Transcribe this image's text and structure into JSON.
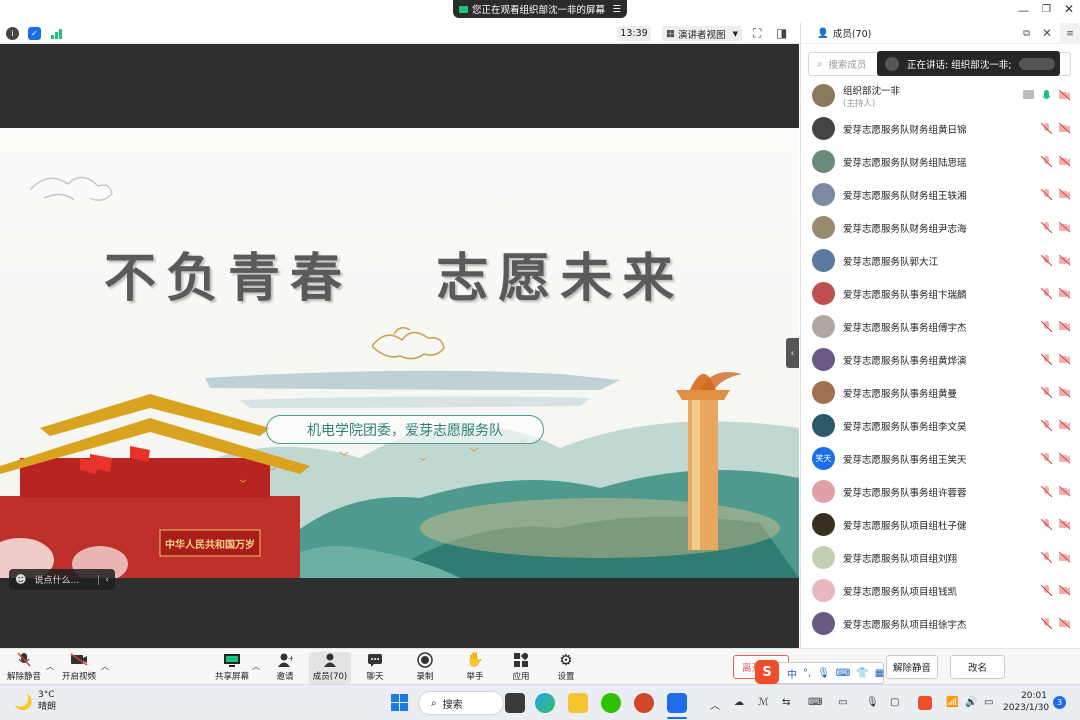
{
  "banner": {
    "text": "您正在观看组织部沈一非的屏幕"
  },
  "toolbar": {
    "time": "13:39",
    "view_label": "演讲者视图"
  },
  "slide": {
    "headline": "不负青春   志愿未来",
    "subtitle": "机电学院团委，爱芽志愿服务队"
  },
  "chat": {
    "placeholder": "说点什么..."
  },
  "panel": {
    "title": "成员(70)",
    "search_placeholder": "搜索成员",
    "speaking": "正在讲话: 组织部沈一非;"
  },
  "members": [
    {
      "name": "组织部沈一非",
      "role": "(主持人)",
      "color": "#8a7a5a"
    },
    {
      "name": "爱芽志愿服务队财务组黄日锦",
      "color": "#444"
    },
    {
      "name": "爱芽志愿服务队财务组陆思瑶",
      "color": "#6a8a7a"
    },
    {
      "name": "爱芽志愿服务队财务组王轶湘",
      "color": "#7a8aa0"
    },
    {
      "name": "爱芽志愿服务队财务组尹志海",
      "color": "#9a8a70"
    },
    {
      "name": "爱芽志愿服务队郭大江",
      "color": "#5a7aa0"
    },
    {
      "name": "爱芽志愿服务队事务组卞瑞麟",
      "color": "#c05050"
    },
    {
      "name": "爱芽志愿服务队事务组傅宇杰",
      "color": "#b0a8a0"
    },
    {
      "name": "爱芽志愿服务队事务组黄烨演",
      "color": "#6a5a8a"
    },
    {
      "name": "爱芽志愿服务队事务组黄曼",
      "color": "#a07050"
    },
    {
      "name": "爱芽志愿服务队事务组李文昊",
      "color": "#2a5a6a"
    },
    {
      "name": "爱芽志愿服务队事务组王笑天",
      "color": "#1a6ee8",
      "initials": "笑天"
    },
    {
      "name": "爱芽志愿服务队事务组许蓉蓉",
      "color": "#e0a0a8"
    },
    {
      "name": "爱芽志愿服务队项目组杜子健",
      "color": "#3a3020"
    },
    {
      "name": "爱芽志愿服务队项目组刘翔",
      "color": "#c0d0b0"
    },
    {
      "name": "爱芽志愿服务队项目组钱凯",
      "color": "#e8b8c0"
    },
    {
      "name": "爱芽志愿服务队项目组徐宇杰",
      "color": "#6a5a80"
    }
  ],
  "controls": {
    "unmute": "解除静音",
    "video": "开启视频",
    "share": "共享屏幕",
    "invite": "邀请",
    "members": "成员(70)",
    "chat": "聊天",
    "record": "录制",
    "raise_hand": "举手",
    "apps": "应用",
    "settings": "设置",
    "leave": "离开会议",
    "unmute_all": "解除静音",
    "rename": "改名"
  },
  "ime": {
    "lang": "中"
  },
  "taskbar": {
    "weather_temp": "3°C",
    "weather_desc": "晴朗",
    "search": "搜索",
    "clock_time": "20:01",
    "clock_date": "2023/1/30",
    "notif_count": "3"
  }
}
